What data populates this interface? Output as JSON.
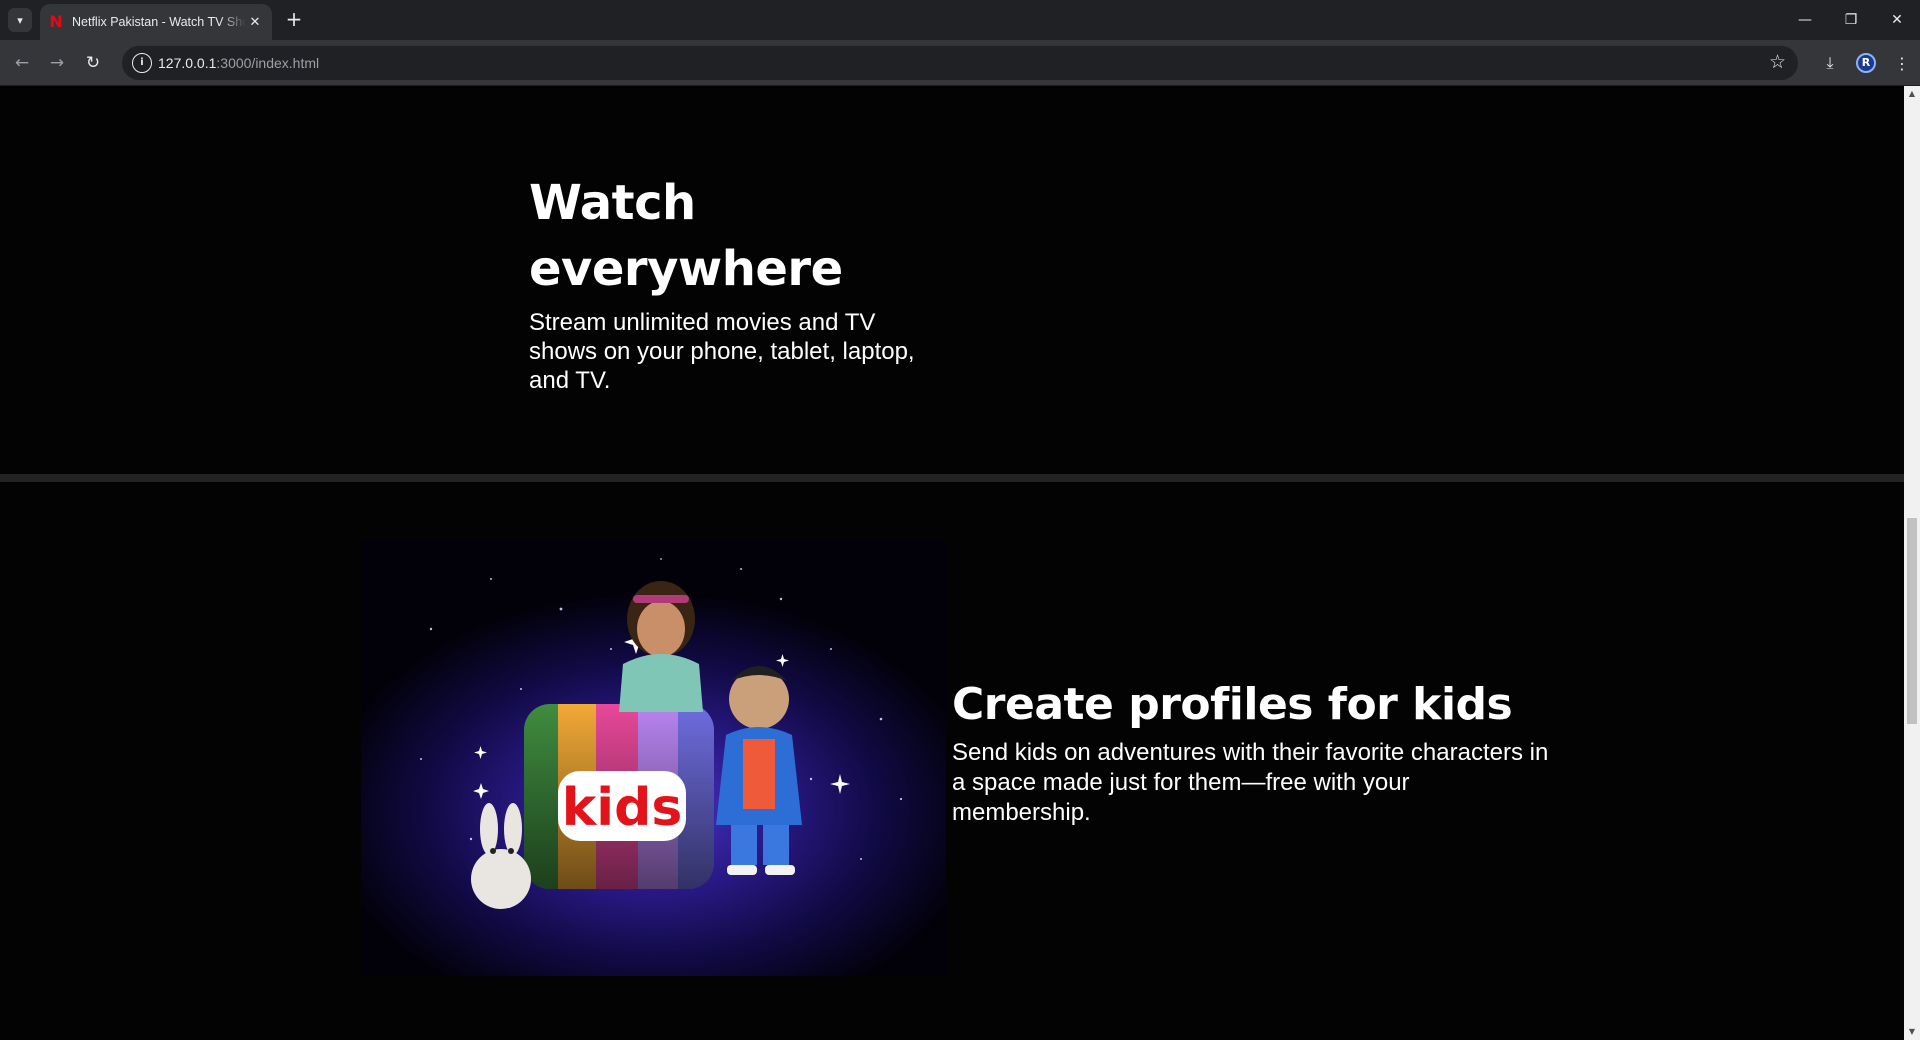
{
  "browser": {
    "tab": {
      "title": "Netflix Pakistan - Watch TV Shows Online, Watch Movies Online",
      "favicon": "netflix-n-icon"
    },
    "url": {
      "host": "127.0.0.1",
      "rest": ":3000/index.html"
    },
    "profile_initial": "R",
    "icons": {
      "tab_search": "chevron-down-icon",
      "new_tab": "plus-icon",
      "back": "arrow-left-icon",
      "forward": "arrow-right-icon",
      "reload": "reload-icon",
      "site_info": "info-icon",
      "bookmark": "star-icon",
      "downloads": "download-icon",
      "menu": "kebab-menu-icon",
      "minimize": "minimize-icon",
      "restore": "restore-icon",
      "close": "close-icon"
    }
  },
  "sections": {
    "watch": {
      "title": "Watch everywhere",
      "description": "Stream unlimited movies and TV shows on your phone, tablet, laptop, and TV."
    },
    "kids": {
      "title": "Create profiles for kids",
      "description": "Send kids on adventures with their favorite characters in a space made just for them—free with your membership.",
      "image_label": "kids"
    }
  },
  "colors": {
    "page_background": "#000000",
    "divider": "#232323",
    "text": "#ffffff",
    "netflix_red": "#e50914",
    "kids_red": "#e3131b"
  }
}
